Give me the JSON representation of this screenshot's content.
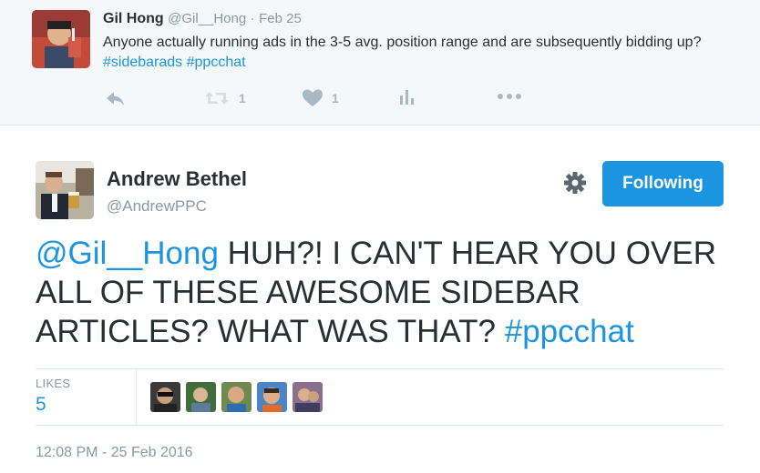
{
  "parent_tweet": {
    "name": "Gil Hong",
    "handle": "@Gil__Hong",
    "separator": "·",
    "date": "Feb 25",
    "text": "Anyone actually running ads in the 3-5 avg. position range and are subsequently bidding up?",
    "hashtag1": "#sidebarads",
    "hashtag2": "#ppcchat",
    "retweet_count": "1",
    "like_count": "1",
    "icons": [
      "reply-icon",
      "retweet-icon",
      "heart-icon",
      "analytics-icon",
      "more-icon"
    ]
  },
  "main_tweet": {
    "name": "Andrew Bethel",
    "handle": "@AndrewPPC",
    "follow_label": "Following",
    "mention": "@Gil__Hong",
    "text": "HUH?!  I CAN'T HEAR YOU OVER ALL OF THESE AWESOME SIDEBAR ARTICLES?  WHAT WAS THAT?",
    "hashtag": "#ppcchat",
    "likes_label": "LIKES",
    "likes_count": "5",
    "timestamp": "12:08 PM - 25 Feb 2016"
  },
  "colors": {
    "link": "#1b95e0",
    "button": "#1b95e0",
    "muted": "#8899a6",
    "text": "#292f33"
  }
}
